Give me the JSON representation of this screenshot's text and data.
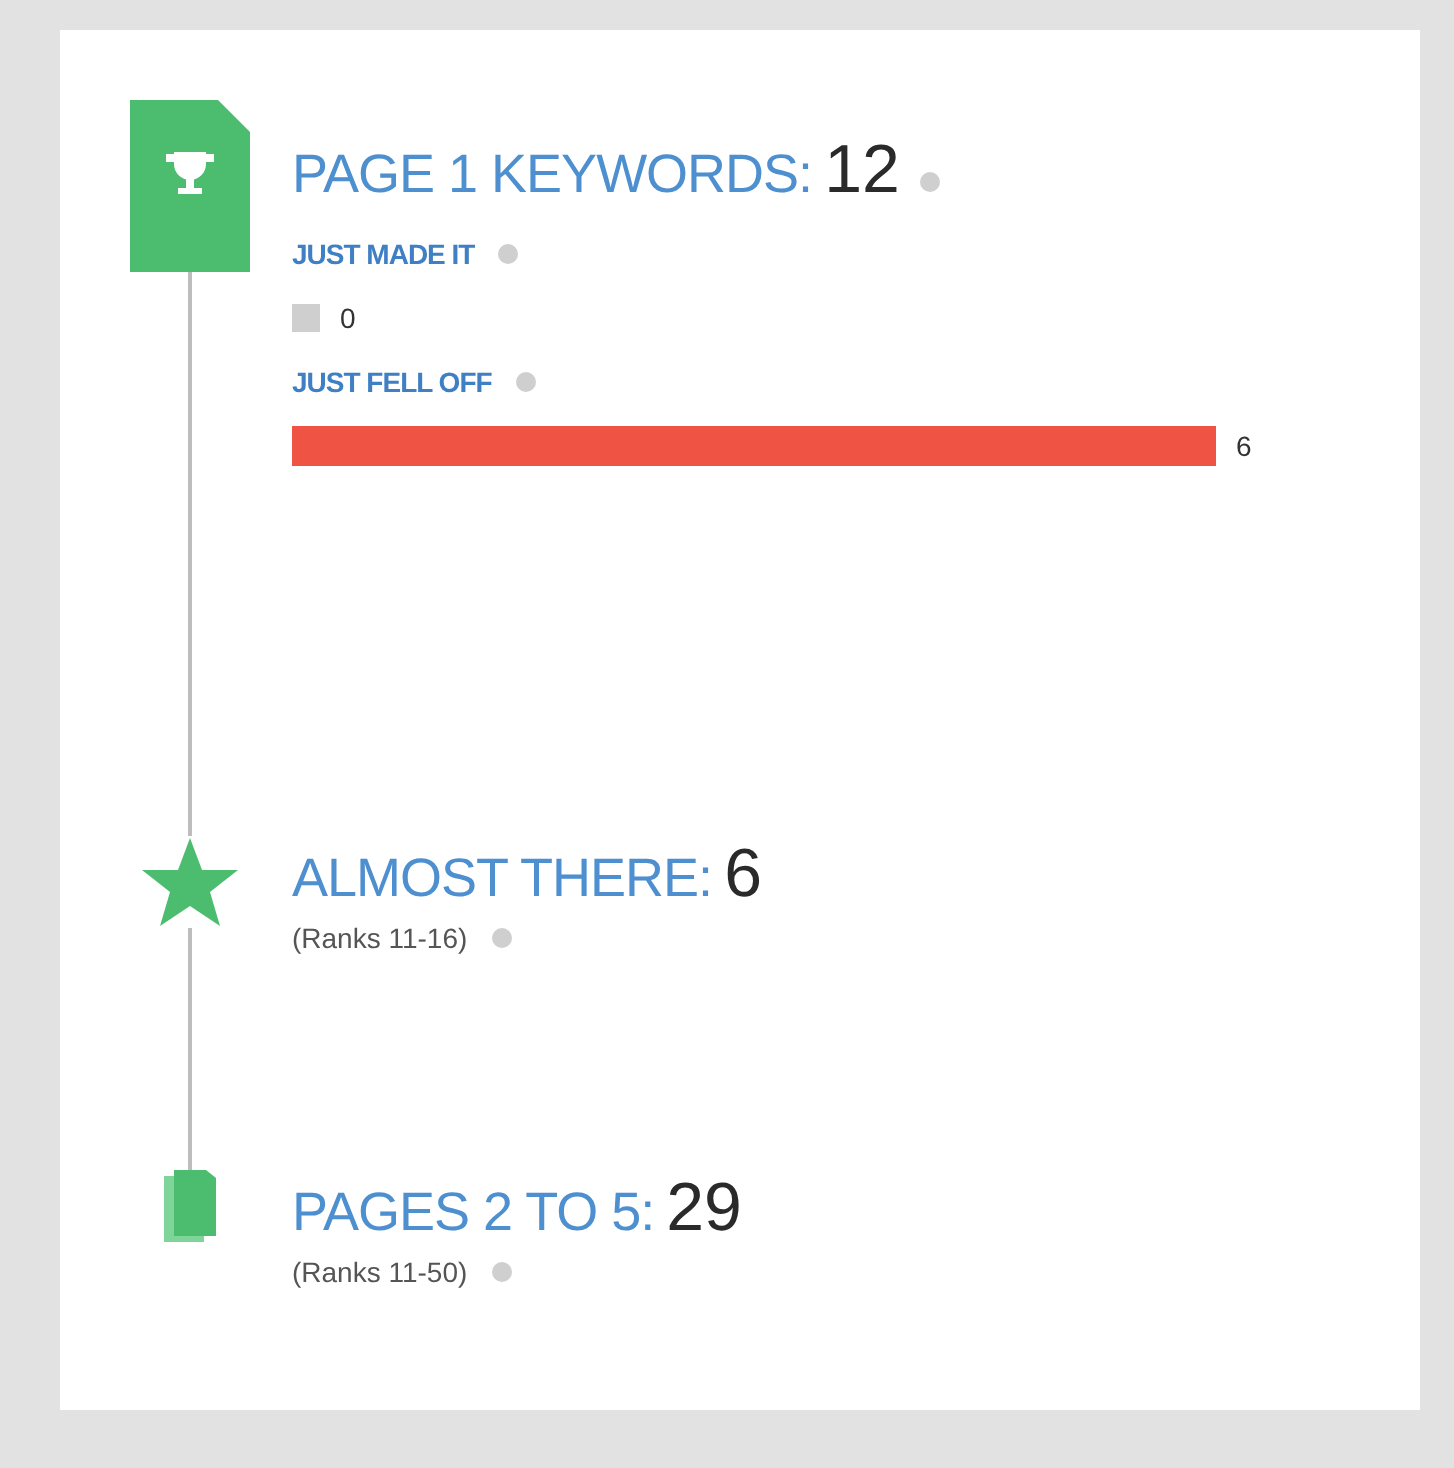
{
  "sections": [
    {
      "kind": "trophy",
      "title": "PAGE 1 KEYWORDS:",
      "count": "12",
      "help": true,
      "bars": [
        {
          "label": "JUST MADE IT",
          "kind": "empty",
          "value": "0"
        },
        {
          "label": "JUST FELL OFF",
          "kind": "full",
          "value": "6"
        }
      ]
    },
    {
      "kind": "star",
      "title": "ALMOST THERE:",
      "count": "6",
      "help": false,
      "note": "(Ranks 11-16)"
    },
    {
      "kind": "pages",
      "title": "PAGES 2 TO 5:",
      "count": "29",
      "help": false,
      "note": "(Ranks 11-50)"
    }
  ]
}
